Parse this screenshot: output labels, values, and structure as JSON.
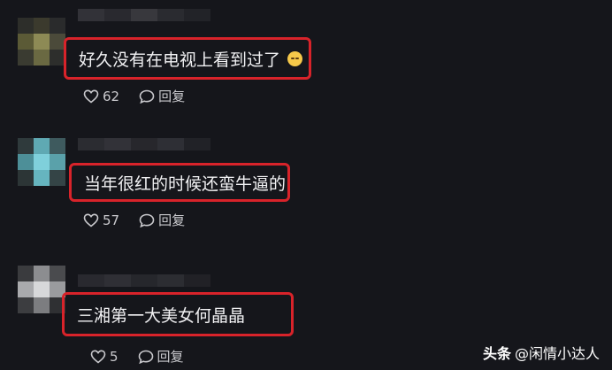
{
  "comments": [
    {
      "text": "好久没有在电视上看到过了",
      "emoji_icon": "smile-emoji-icon",
      "likes": "62",
      "reply_label": "回复"
    },
    {
      "text": "当年很红的时候还蛮牛逼的",
      "likes": "57",
      "reply_label": "回复"
    },
    {
      "text": "三湘第一大美女何晶晶",
      "likes": "5",
      "reply_label": "回复"
    }
  ],
  "watermark": {
    "brand": "头条",
    "handle": "@闲情小达人"
  },
  "colors": {
    "background": "#15161b",
    "highlight_border": "#d8232a",
    "text": "#f1f1f3",
    "meta_text": "#c9c9cd"
  }
}
